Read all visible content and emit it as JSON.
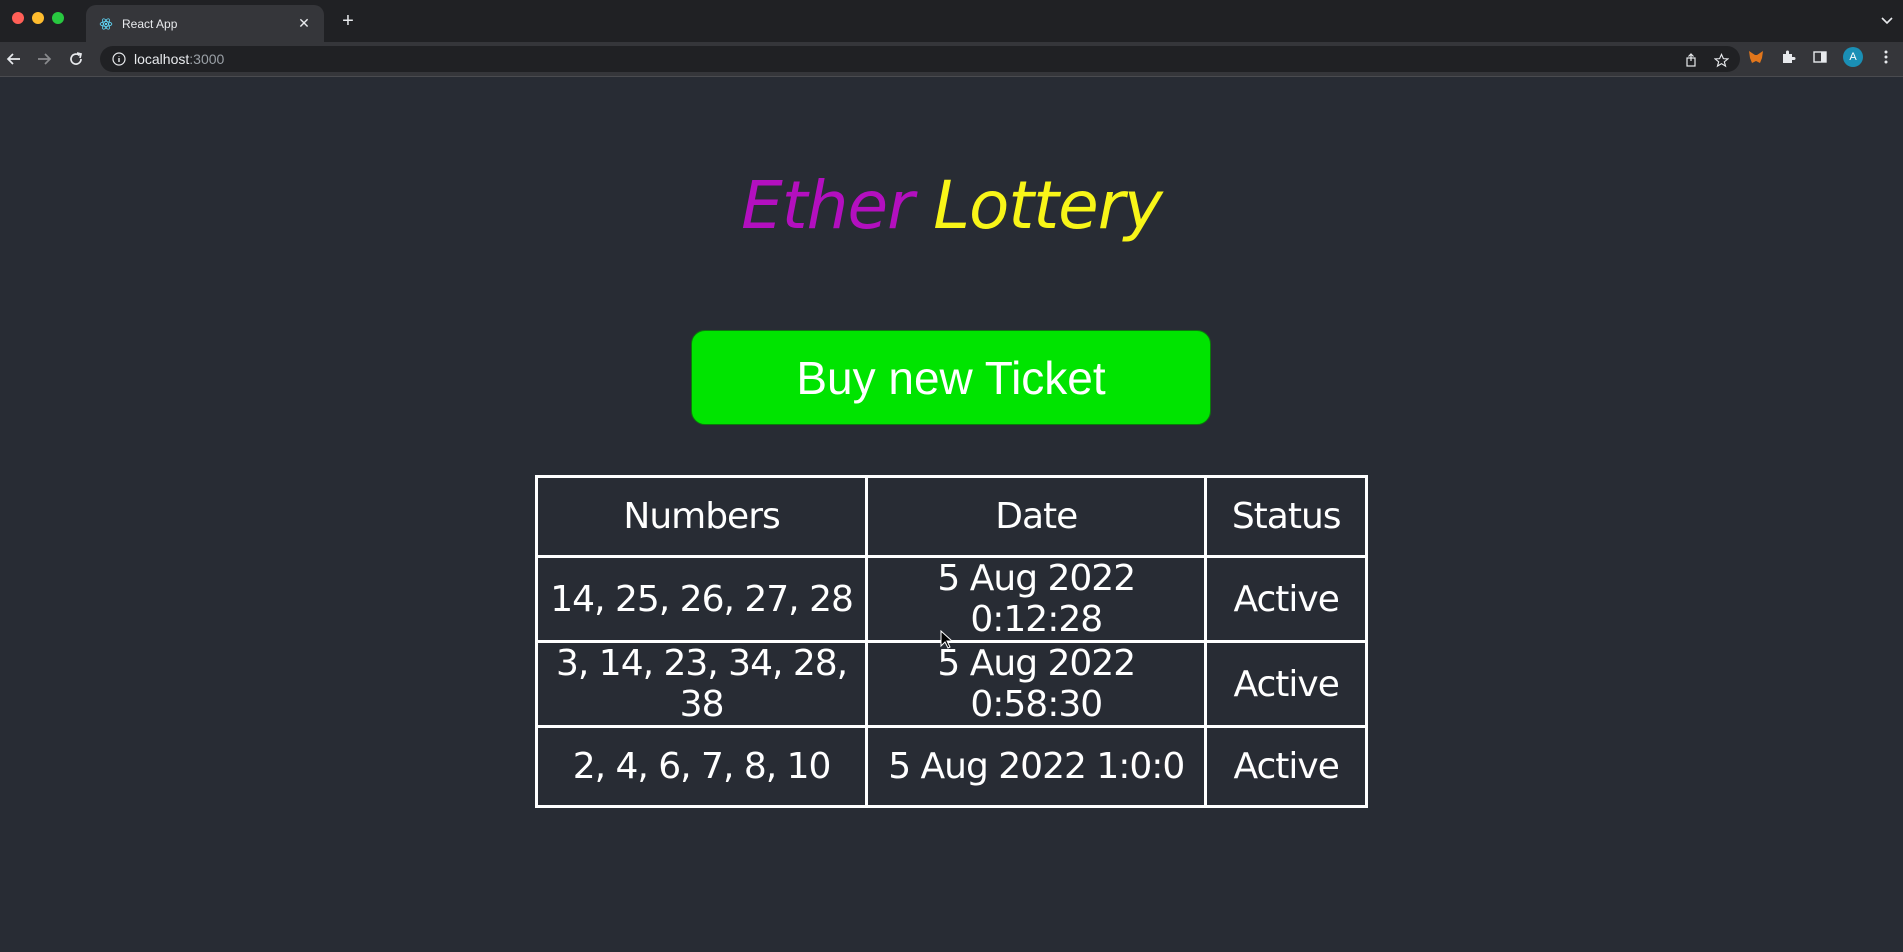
{
  "browser": {
    "tab_title": "React App",
    "url_host": "localhost",
    "url_port": ":3000",
    "avatar_letter": "A"
  },
  "page": {
    "title_part1": "Ether",
    "title_part2": "Lottery",
    "buy_button_label": "Buy new Ticket",
    "colors": {
      "background": "#282c34",
      "title_part1": "#b30fbf",
      "title_part2": "#f8f518",
      "button": "#00e400"
    }
  },
  "table": {
    "headers": [
      "Numbers",
      "Date",
      "Status"
    ],
    "rows": [
      [
        "14, 25, 26, 27, 28",
        "5 Aug 2022 0:12:28",
        "Active"
      ],
      [
        "3, 14, 23, 34, 28, 38",
        "5 Aug 2022 0:58:30",
        "Active"
      ],
      [
        "2, 4, 6, 7, 8, 10",
        "5 Aug 2022 1:0:0",
        "Active"
      ]
    ]
  }
}
